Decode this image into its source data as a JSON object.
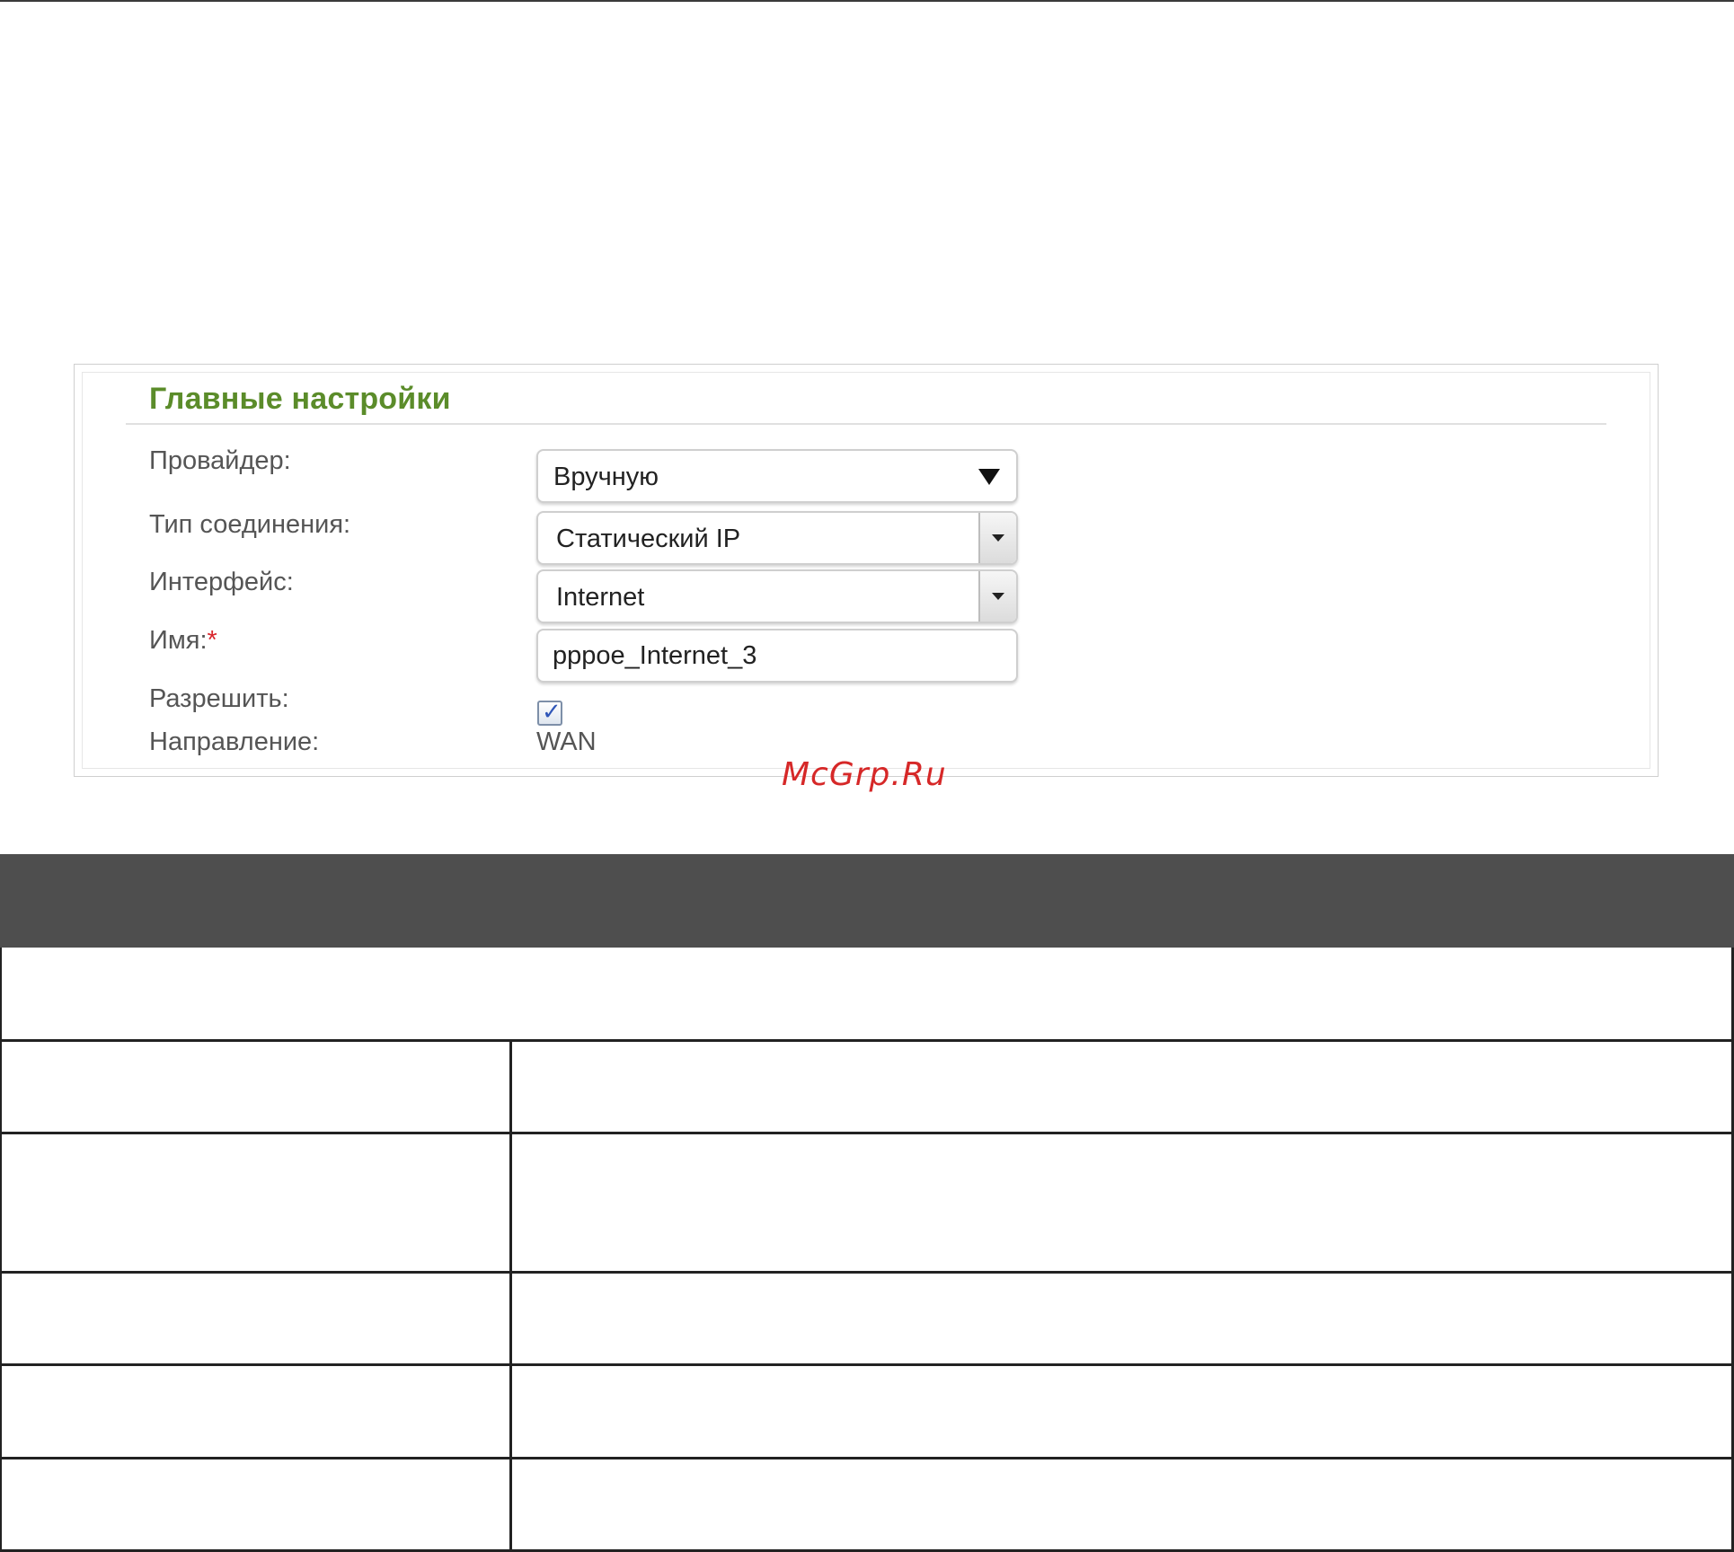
{
  "section": {
    "title": "Главные настройки"
  },
  "fields": {
    "provider_label": "Провайдер:",
    "provider_value": "Вручную",
    "connection_type_label": "Тип соединения:",
    "connection_type_value": "Статический IP",
    "interface_label": "Интерфейс:",
    "interface_value": "Internet",
    "name_label": "Имя:",
    "name_required_mark": "*",
    "name_value": "pppoe_Internet_3",
    "enable_label": "Разрешить:",
    "enable_checked": true,
    "direction_label": "Направление:",
    "direction_value": "WAN"
  },
  "watermark": "McGrp.Ru",
  "icons": {
    "provider_dropdown": "triangle-down-icon",
    "connection_type_dropdown": "dropdown-arrow-icon",
    "interface_dropdown": "dropdown-arrow-icon",
    "enable_checkbox": "checkmark-icon"
  },
  "colors": {
    "section_title": "#5b8c2a",
    "required_mark": "#d9262c",
    "watermark": "#d62828",
    "table_header": "#4e4e4e"
  }
}
